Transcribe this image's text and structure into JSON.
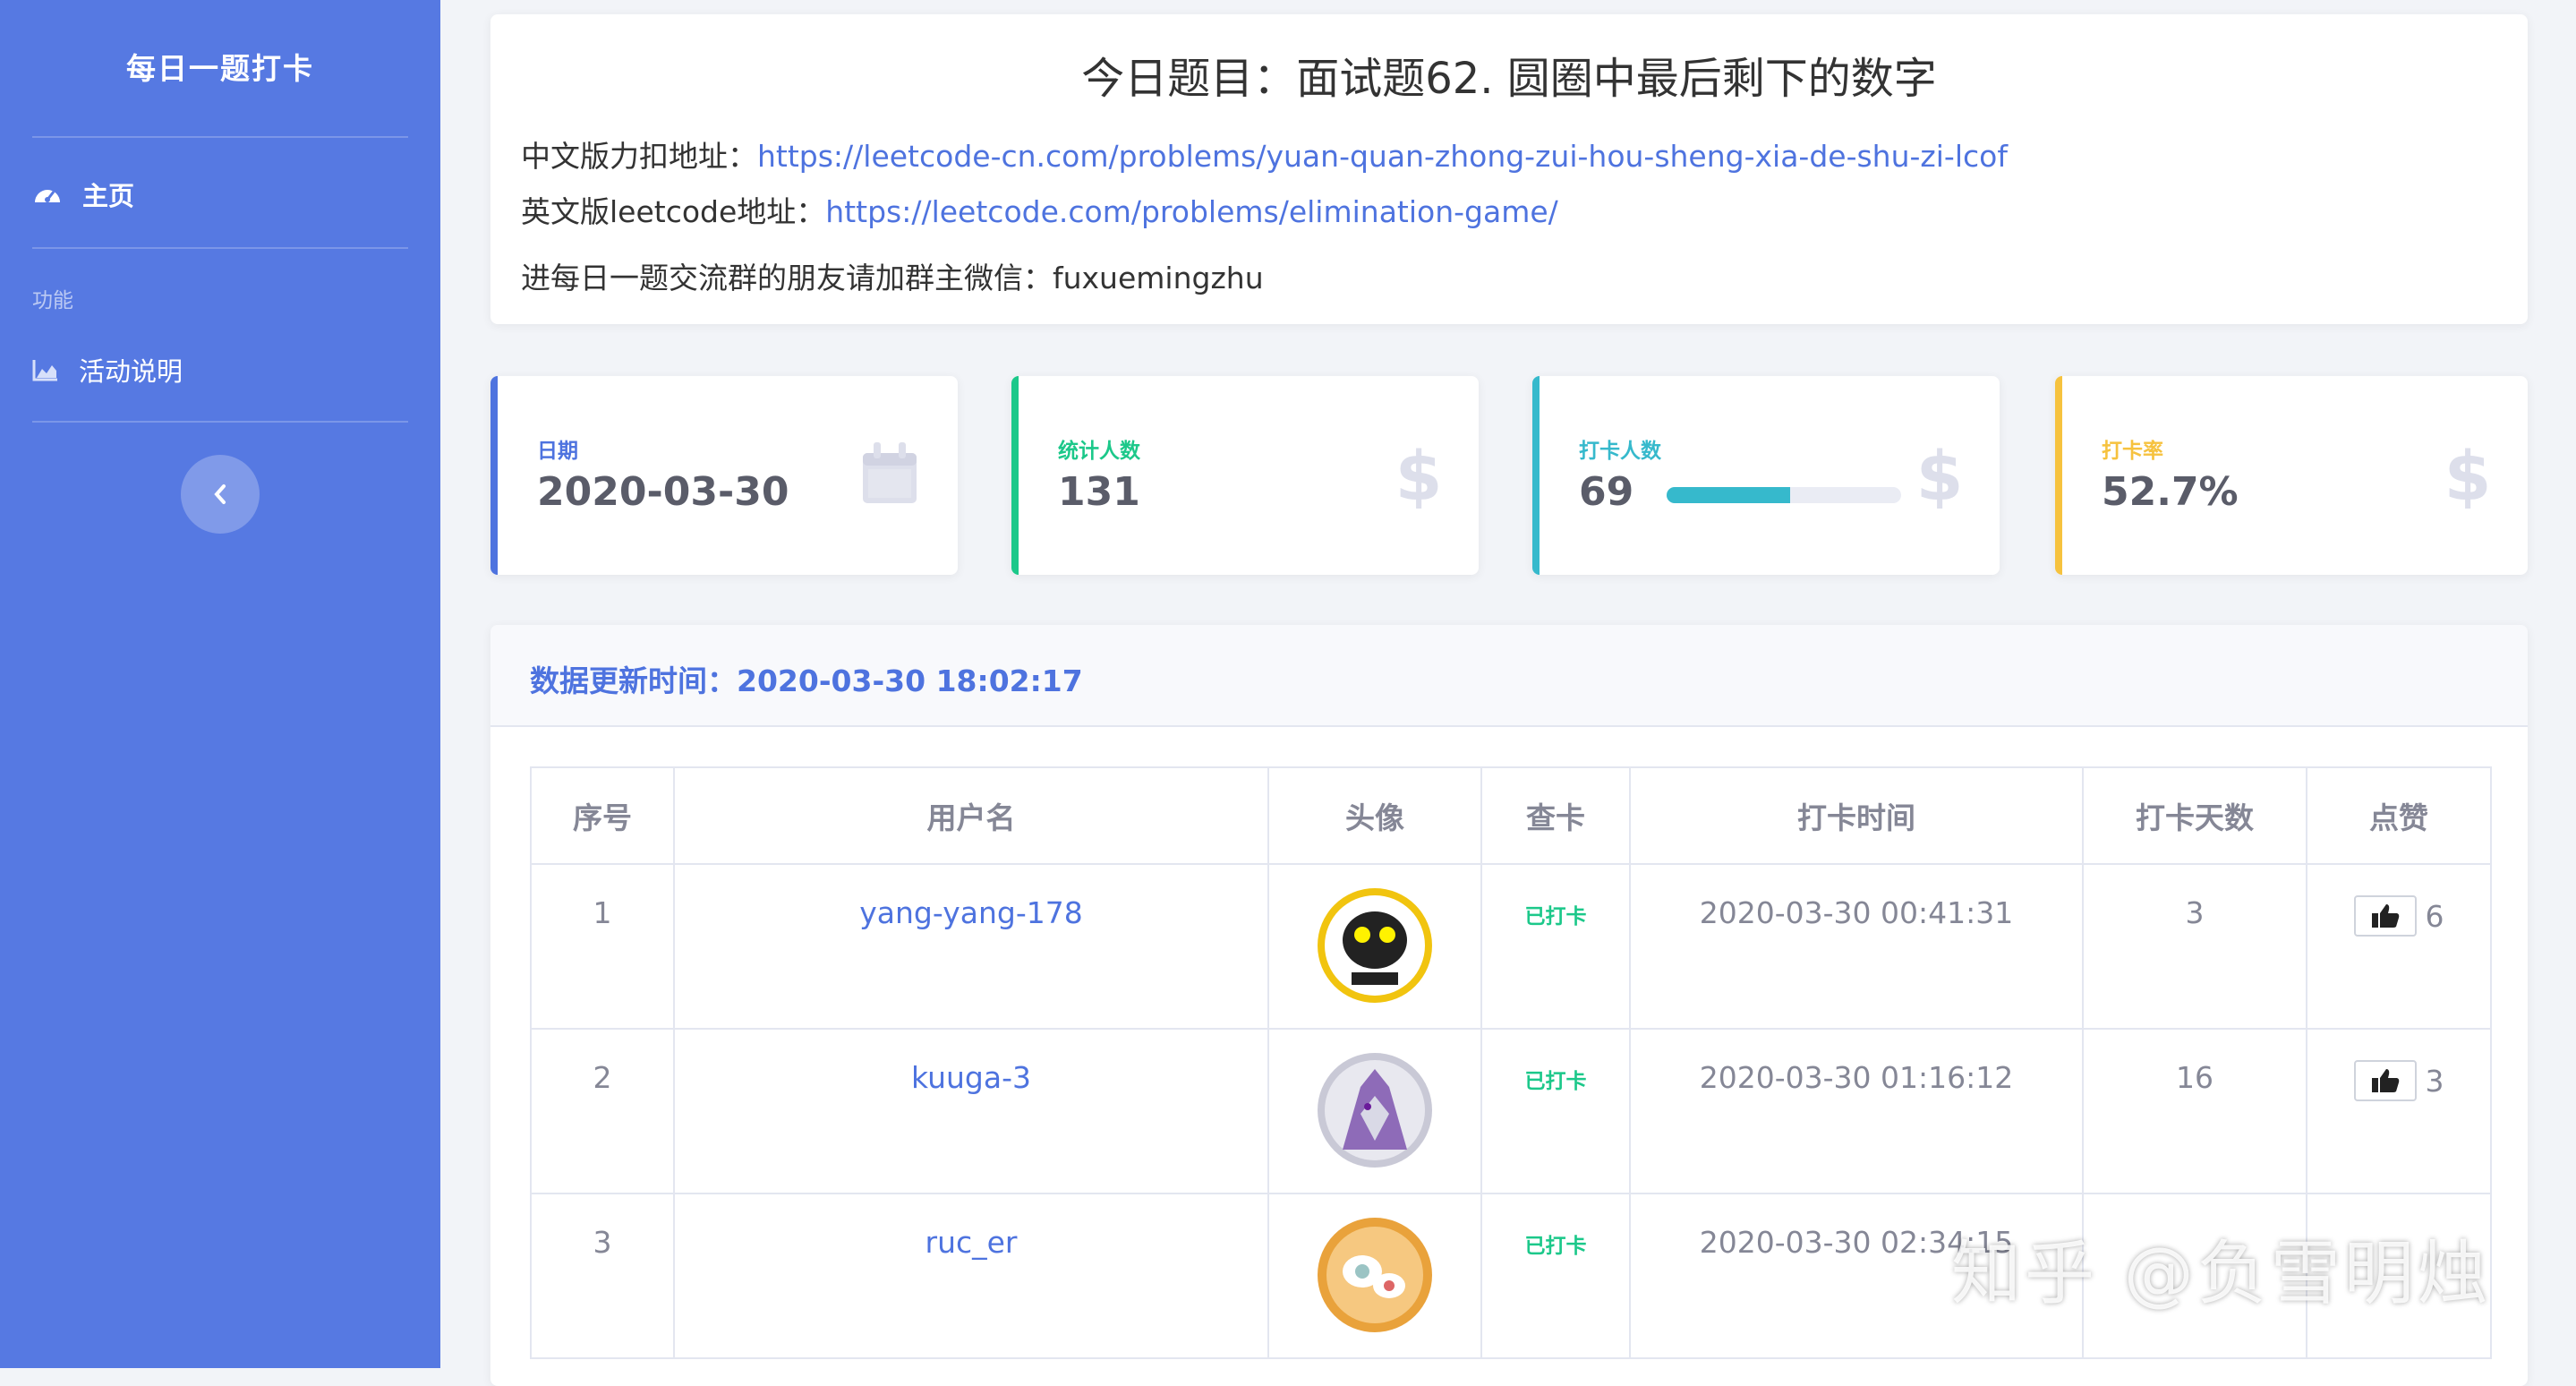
{
  "sidebar": {
    "brand": "每日一题打卡",
    "home": "主页",
    "section_heading": "功能",
    "activity": "活动说明"
  },
  "problem": {
    "title": "今日题目：面试题62. 圆圈中最后剩下的数字",
    "cn_label": "中文版力扣地址：",
    "cn_url": "https://leetcode-cn.com/problems/yuan-quan-zhong-zui-hou-sheng-xia-de-shu-zi-lcof",
    "en_label": "英文版leetcode地址：",
    "en_url": "https://leetcode.com/problems/elimination-game/",
    "wechat_line": "进每日一题交流群的朋友请加群主微信：fuxuemingzhu"
  },
  "stats": {
    "date": {
      "label": "日期",
      "value": "2020-03-30"
    },
    "total": {
      "label": "统计人数",
      "value": "131"
    },
    "checked": {
      "label": "打卡人数",
      "value": "69",
      "progress": 0.527
    },
    "rate": {
      "label": "打卡率",
      "value": "52.7%"
    }
  },
  "colors": {
    "blue": "#4e73df",
    "green": "#1cc88a",
    "cyan": "#36b9cc",
    "yellow": "#f6c23e"
  },
  "table": {
    "update_label": "数据更新时间：2020-03-30 18:02:17",
    "headers": [
      "序号",
      "用户名",
      "头像",
      "查卡",
      "打卡时间",
      "打卡天数",
      "点赞"
    ],
    "rows": [
      {
        "index": "1",
        "user": "yang-yang-178",
        "status": "已打卡",
        "time": "2020-03-30 00:41:31",
        "days": "3",
        "likes": "6"
      },
      {
        "index": "2",
        "user": "kuuga-3",
        "status": "已打卡",
        "time": "2020-03-30 01:16:12",
        "days": "16",
        "likes": "3"
      },
      {
        "index": "3",
        "user": "ruc_er",
        "status": "已打卡",
        "time": "2020-03-30 02:34:15",
        "days": "",
        "likes": ""
      }
    ]
  },
  "watermark": "知乎 @负雪明烛"
}
